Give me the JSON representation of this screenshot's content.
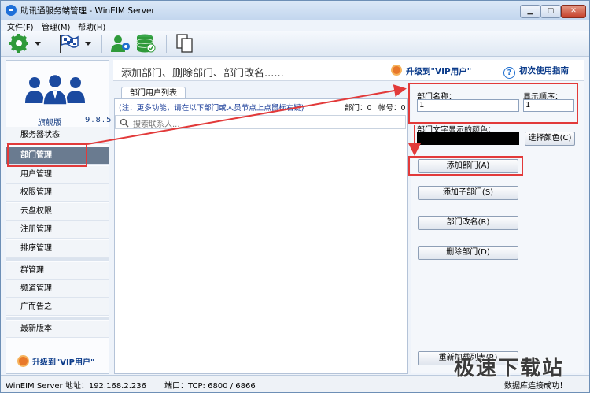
{
  "window": {
    "title": "助讯通服务端管理 - WinEIM Server"
  },
  "menu": [
    "文件(F)",
    "管理(M)",
    "帮助(H)"
  ],
  "toolbar_icons": [
    "gear-icon",
    "flag-icon",
    "settings-user-icon",
    "database-icon",
    "copy-icon"
  ],
  "sidebar": {
    "edition": "旗舰版",
    "version": "9.8.5",
    "items": [
      "服务器状态",
      "部门管理",
      "用户管理",
      "权限管理",
      "云盘权限",
      "注册管理",
      "排序管理",
      "群管理",
      "频道管理",
      "广而告之",
      "最新版本"
    ],
    "active_index": 1,
    "upgrade_label": "升级到\"VIP用户\""
  },
  "header": {
    "text": "添加部门、删除部门、部门改名......",
    "upgrade_link": "升级到\"VIP用户\"",
    "guide_link": "初次使用指南"
  },
  "dept_panel": {
    "tab_label": "部门用户列表",
    "note": "(注：更多功能，请在以下部门或人员节点上点鼠标右键)",
    "dept_count": "部门：0",
    "account_count": "帐号：0",
    "search_placeholder": "搜索联系人..."
  },
  "form": {
    "dept_name_label": "部门名称：",
    "dept_name_value": "1",
    "order_label": "显示顺序：",
    "order_value": "1",
    "color_label": "部门文字显示的颜色：",
    "color_value": "#000000",
    "choose_color": "选择颜色(C)",
    "add_dept": "添加部门(A)",
    "add_sub_dept": "添加子部门(S)",
    "rename_dept": "部门改名(R)",
    "delete_dept": "删除部门(D)",
    "reload_list": "重新加载列表(R)"
  },
  "status": {
    "server_address": "WinEIM Server 地址：192.168.2.236",
    "port": "端口：TCP: 6800 / 6866",
    "connection": "数据库连接成功！"
  },
  "colors": {
    "highlight": "#e23a3a",
    "active_nav": "#6a7b90",
    "link": "#0b3b8a"
  },
  "watermark": "极速下载站"
}
